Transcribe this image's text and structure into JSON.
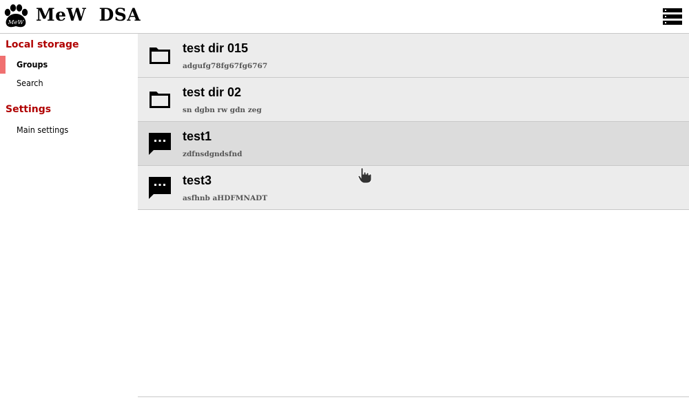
{
  "header": {
    "logo_text": "MeW",
    "title": "MeW  DSA",
    "menu_icon": "server-list-icon"
  },
  "sidebar": {
    "sections": [
      {
        "title": "Local storage",
        "items": [
          {
            "label": "Groups",
            "active": true
          },
          {
            "label": "Search",
            "active": false
          }
        ]
      },
      {
        "title": "Settings",
        "items": [
          {
            "label": "Main settings",
            "active": false
          }
        ]
      }
    ],
    "active_marker_color": "#f07070",
    "section_title_color": "#b00000"
  },
  "list": {
    "items": [
      {
        "icon": "folder-icon",
        "title": "test dir 015",
        "subtitle": "adgufg78fg67fg6767"
      },
      {
        "icon": "folder-icon",
        "title": "test dir 02",
        "subtitle": "sn dgbn rw gdn zeg"
      },
      {
        "icon": "chat-icon",
        "title": "test1",
        "subtitle": "zdfnsdgndsfnd",
        "hovered": true
      },
      {
        "icon": "chat-icon",
        "title": "test3",
        "subtitle": "asfhnb aHDFMNADT"
      }
    ],
    "background": "#ececec",
    "hover_background": "#dcdcdc"
  }
}
